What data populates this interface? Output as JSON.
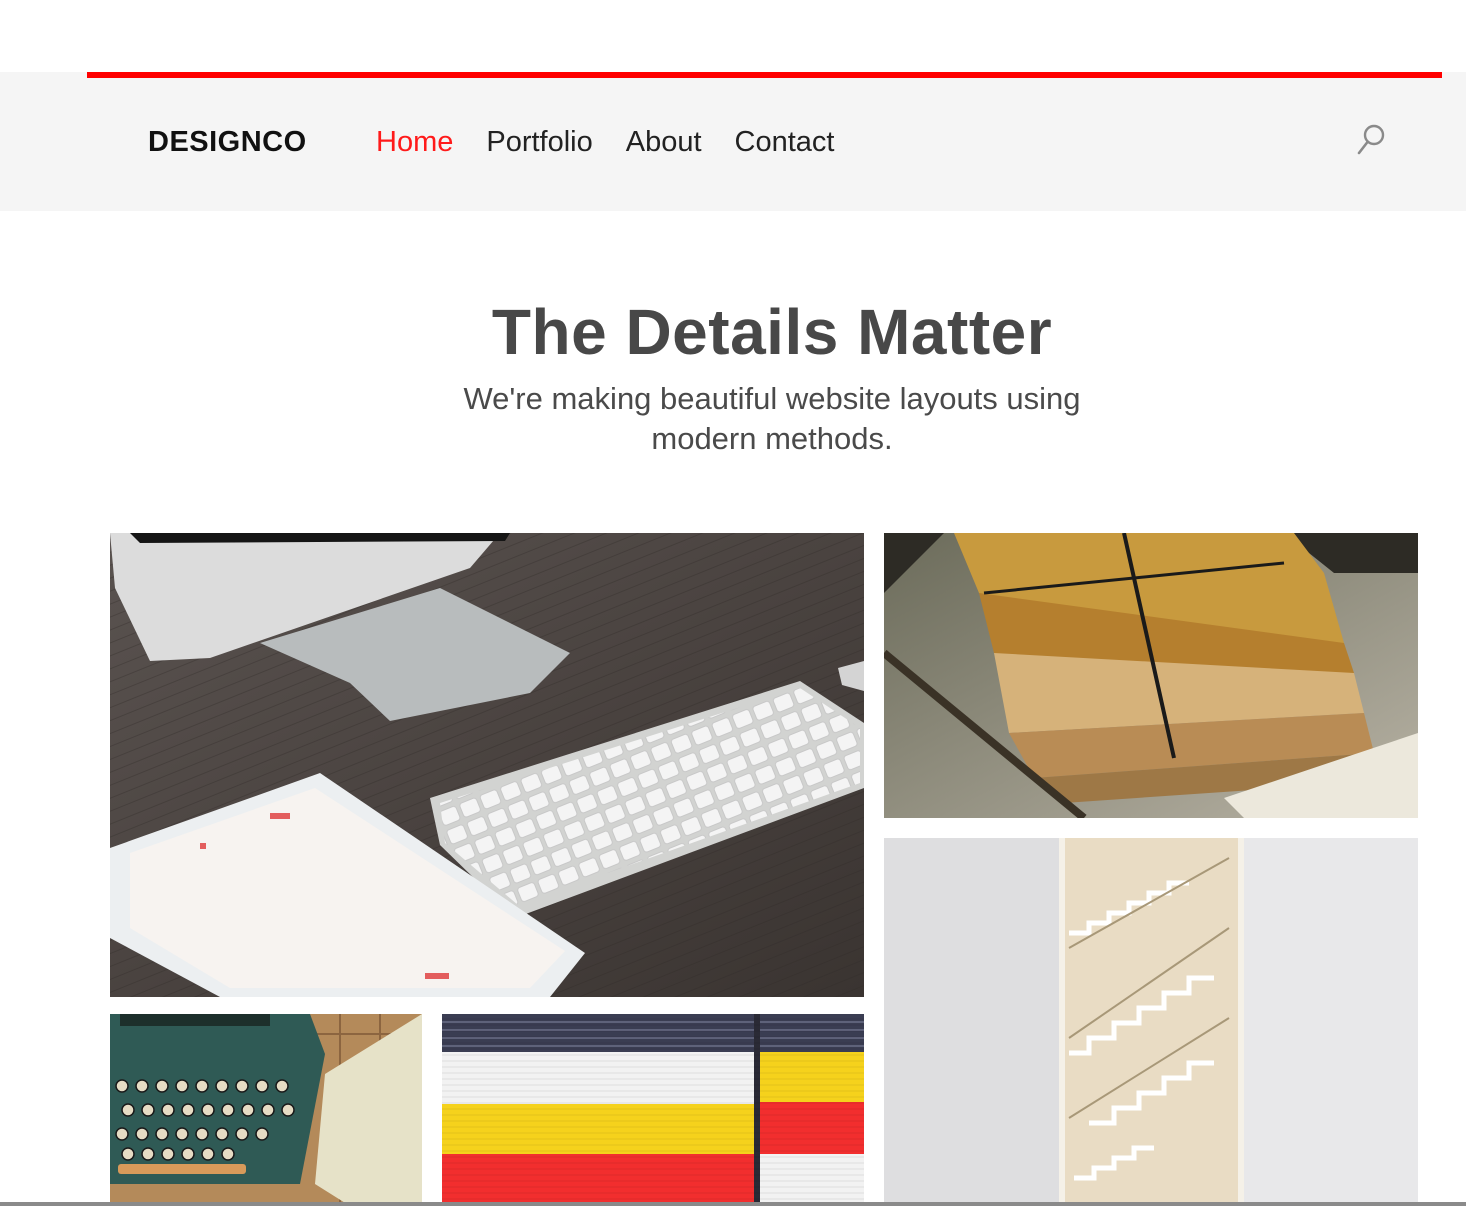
{
  "brand": "DESIGNCO",
  "nav": {
    "items": [
      {
        "label": "Home",
        "active": true
      },
      {
        "label": "Portfolio",
        "active": false
      },
      {
        "label": "About",
        "active": false
      },
      {
        "label": "Contact",
        "active": false
      }
    ],
    "search_icon": "search-icon"
  },
  "hero": {
    "title": "The Details Matter",
    "subtitle": "We're making beautiful website layouts using modern methods."
  },
  "gallery": [
    {
      "name": "desk-imac-keyboard-ipad-photo"
    },
    {
      "name": "stack-of-paper-packages-photo"
    },
    {
      "name": "staircase-photo"
    },
    {
      "name": "typewriter-photo"
    },
    {
      "name": "striped-colorful-wall-photo"
    }
  ],
  "colors": {
    "accent": "#ff0000",
    "active_nav": "#ff1a1a",
    "header_bg": "#f5f5f5",
    "title": "#484848"
  }
}
